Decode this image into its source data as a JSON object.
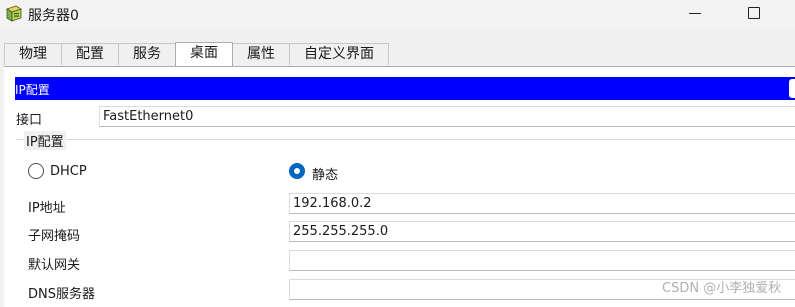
{
  "window": {
    "title": "服务器0"
  },
  "tabs": [
    {
      "label": "物理",
      "active": false
    },
    {
      "label": "配置",
      "active": false
    },
    {
      "label": "服务",
      "active": false
    },
    {
      "label": "桌面",
      "active": true
    },
    {
      "label": "属性",
      "active": false
    },
    {
      "label": "自定义界面",
      "active": false
    }
  ],
  "ip_config": {
    "section_title": "IP配置",
    "interface_label": "接口",
    "interface_value": "FastEthernet0",
    "group_label": "IP配置",
    "mode_dhcp_label": "DHCP",
    "mode_static_label": "静态",
    "selected_mode": "静态",
    "rows": [
      {
        "label": "IP地址",
        "value": "192.168.0.2"
      },
      {
        "label": "子网掩码",
        "value": "255.255.255.0"
      },
      {
        "label": "默认网关",
        "value": ""
      },
      {
        "label": "DNS服务器",
        "value": ""
      }
    ]
  },
  "watermark": "CSDN @小李独爱秋",
  "colors": {
    "section_bar": "#0000ff",
    "radio_selected": "#0067c0"
  }
}
